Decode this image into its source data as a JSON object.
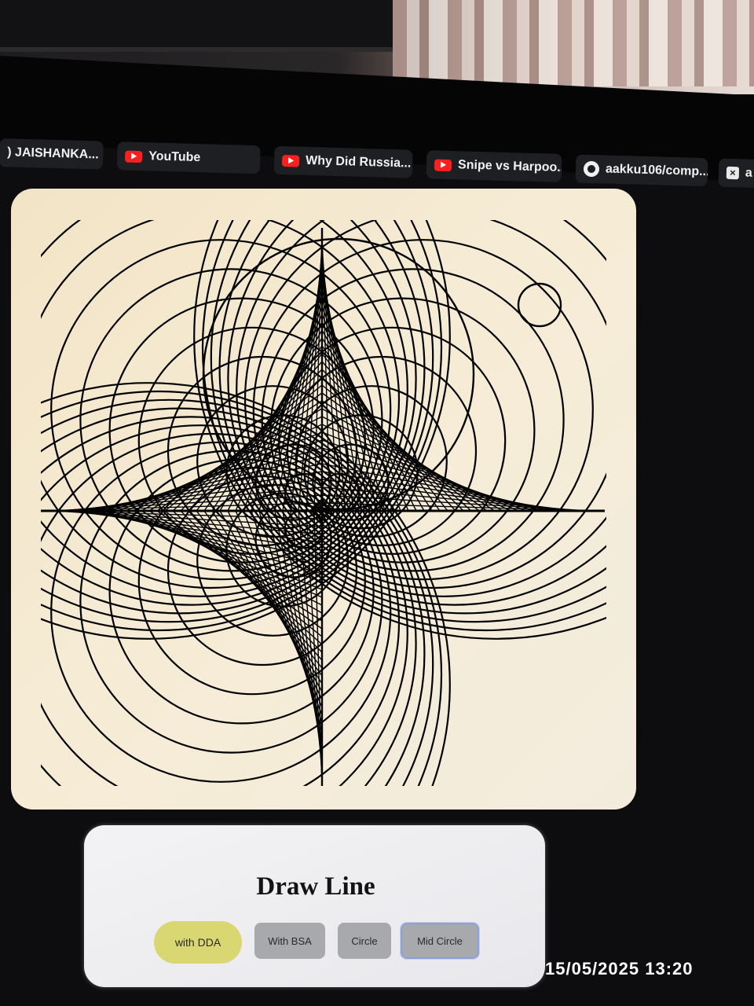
{
  "browser": {
    "tabs": [
      {
        "label": ") JAISHANKA...",
        "icon": "none"
      },
      {
        "label": "YouTube",
        "icon": "youtube-icon"
      },
      {
        "label": "Why Did Russia...",
        "icon": "youtube-icon"
      },
      {
        "label": "Snipe vs Harpoo...",
        "icon": "youtube-icon"
      },
      {
        "label": "aakku106/comp...",
        "icon": "github-icon"
      },
      {
        "label": "a",
        "icon": "close-square-icon"
      }
    ]
  },
  "panel": {
    "title": "Draw Line",
    "buttons": {
      "dda": "with DDA",
      "bsa": "With BSA",
      "circle": "Circle",
      "mid_circle": "Mid Circle"
    }
  },
  "overlay": {
    "timestamp": "15/05/2025  13:20"
  },
  "colors": {
    "canvas_background": "#f4e8d0",
    "stroke": "#000000",
    "dda_button": "#d9d771",
    "button_gray": "#a8a9ad",
    "focus_ring": "#8ea0d9"
  }
}
